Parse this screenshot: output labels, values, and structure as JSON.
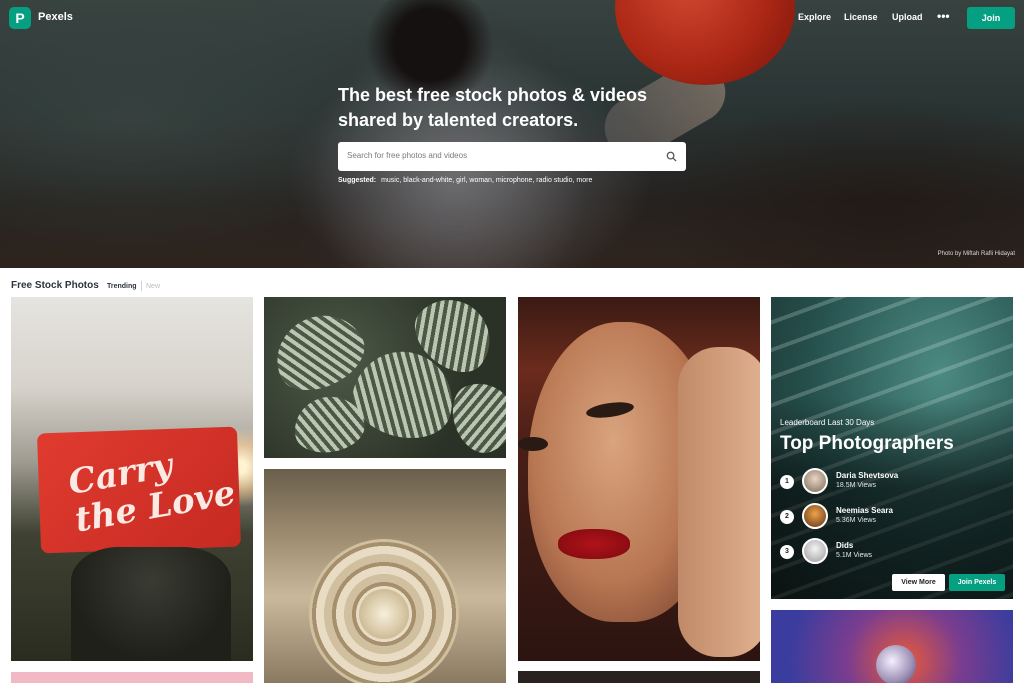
{
  "nav": {
    "brand": "Pexels",
    "logo_glyph": "P",
    "links": [
      "Explore",
      "License",
      "Upload"
    ],
    "more": "•••",
    "join": "Join"
  },
  "hero": {
    "headline_line1": "The best free stock photos & videos",
    "headline_line2": "shared by talented creators.",
    "search_placeholder": "Search for free photos and videos",
    "suggested_label": "Suggested:",
    "suggested_terms": "music, black-and-white, girl, woman, microphone, radio studio, more",
    "credit": "Photo by Miftah Rafli Hidayat"
  },
  "section": {
    "title": "Free Stock Photos",
    "tab_trending": "Trending",
    "tab_new": "New"
  },
  "photos": {
    "p1_flag_text": "Carry the Love"
  },
  "leaderboard": {
    "kicker": "Leaderboard Last 30 Days",
    "title": "Top Photographers",
    "rows": [
      {
        "rank": "1",
        "name": "Daria Shevtsova",
        "views": "18.5M Views"
      },
      {
        "rank": "2",
        "name": "Neemias Seara",
        "views": "5.36M Views"
      },
      {
        "rank": "3",
        "name": "Dids",
        "views": "5.1M Views"
      }
    ],
    "view_more": "View More",
    "join_pexels": "Join Pexels"
  },
  "colors": {
    "brand_green": "#05a081"
  }
}
